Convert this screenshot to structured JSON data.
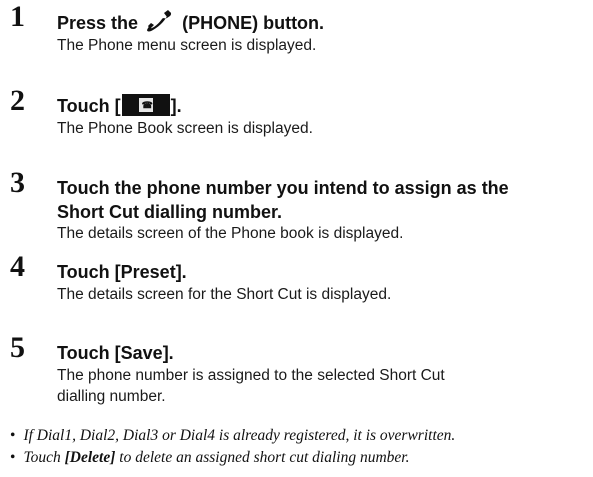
{
  "steps": [
    {
      "number": "1",
      "heading_before": "Press the",
      "heading_after": "(PHONE) button.",
      "description": "The Phone menu screen is displayed."
    },
    {
      "number": "2",
      "heading_before": "Touch [",
      "heading_after": "].",
      "description": "The Phone Book screen is displayed."
    },
    {
      "number": "3",
      "heading_line1": "Touch the phone number you intend to assign as the",
      "heading_line2": "Short Cut dialling number.",
      "description": "The details screen of the Phone book is displayed."
    },
    {
      "number": "4",
      "heading": "Touch [Preset].",
      "description": "The details screen for the Short Cut is displayed."
    },
    {
      "number": "5",
      "heading": "Touch [Save].",
      "description_line1": "The phone number is assigned to the selected Short Cut",
      "description_line2": "dialling number."
    }
  ],
  "notes": {
    "bullet": "•",
    "note1": "If Dial1, Dial2, Dial3 or Dial4 is already registered, it is overwritten.",
    "note2_before": "Touch",
    "note2_bold": "[Delete]",
    "note2_after": "to delete an assigned short cut dialing number."
  },
  "icons": {
    "step1": "phone-handset-icon",
    "step2": "phone-book-icon"
  }
}
